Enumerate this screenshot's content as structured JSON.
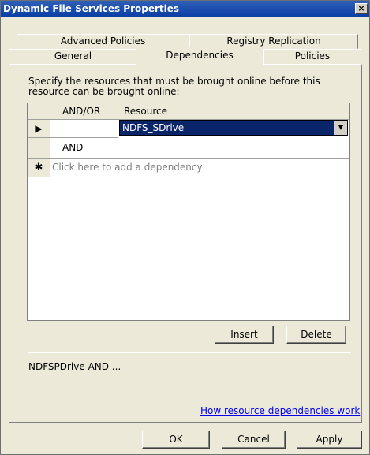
{
  "window": {
    "title": "Dynamic File Services Properties",
    "close_glyph": "×"
  },
  "tabs": {
    "advanced": "Advanced Policies",
    "registry": "Registry Replication",
    "general": "General",
    "dependencies": "Dependencies",
    "policies": "Policies"
  },
  "instruction": "Specify the resources that must be brought online before this resource can be brought online:",
  "grid": {
    "headers": {
      "andor": "AND/OR",
      "resource": "Resource"
    },
    "rows": [
      {
        "marker": "▶",
        "andor": "",
        "resource": "NDFS_SDrive"
      },
      {
        "marker": "",
        "andor": "AND",
        "resource": ""
      },
      {
        "marker": "✱",
        "placeholder": "Click here to add a dependency"
      }
    ]
  },
  "buttons": {
    "insert": "Insert",
    "delete": "Delete",
    "ok": "OK",
    "cancel": "Cancel",
    "apply": "Apply"
  },
  "summary": "NDFSPDrive AND ...",
  "help_link": "How resource dependencies work"
}
